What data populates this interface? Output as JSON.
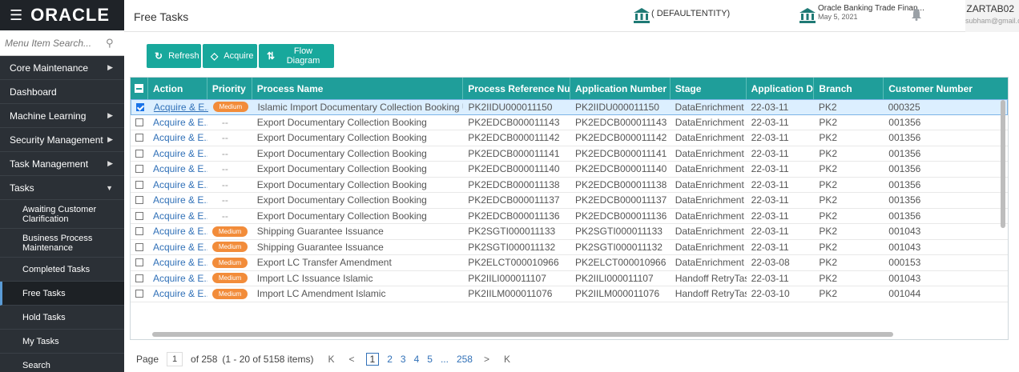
{
  "brand": {
    "logo": "ORACLE"
  },
  "menu": {
    "search_placeholder": "Menu Item Search...",
    "items": [
      {
        "label": "Core Maintenance",
        "has_children": true
      },
      {
        "label": "Dashboard",
        "has_children": false
      },
      {
        "label": "Machine Learning",
        "has_children": true
      },
      {
        "label": "Security Management",
        "has_children": true
      },
      {
        "label": "Task Management",
        "has_children": true
      },
      {
        "label": "Tasks",
        "expanded": true
      }
    ],
    "sub_items": [
      {
        "label": "Awaiting Customer Clarification"
      },
      {
        "label": "Business Process Maintenance"
      },
      {
        "label": "Completed Tasks"
      },
      {
        "label": "Free Tasks",
        "active": true
      },
      {
        "label": "Hold Tasks"
      },
      {
        "label": "My Tasks"
      },
      {
        "label": "Search"
      }
    ]
  },
  "header": {
    "title": "Free Tasks",
    "entity": "( DEFAULTENTITY)",
    "app_name": "Oracle Banking Trade Finan...",
    "app_date": "May 5, 2021",
    "user": "ZARTAB02",
    "email": "subham@gmail.com"
  },
  "toolbar": {
    "refresh": "Refresh",
    "acquire": "Acquire",
    "flow": "Flow Diagram"
  },
  "grid": {
    "columns": [
      "Action",
      "Priority",
      "Process Name",
      "Process Reference Number",
      "Application Number",
      "Stage",
      "Application Date",
      "Branch",
      "Customer Number"
    ],
    "rows": [
      {
        "checked": true,
        "action": "Acquire & E...",
        "priority": "Medium",
        "process": "Islamic Import Documentary Collection Booking Upda...",
        "ref": "PK2IIDU000011150",
        "app": "PK2IIDU000011150",
        "stage": "DataEnrichment",
        "date": "22-03-11",
        "branch": "PK2",
        "customer": "000325"
      },
      {
        "checked": false,
        "action": "Acquire & E...",
        "priority": "--",
        "process": "Export Documentary Collection Booking",
        "ref": "PK2EDCB000011143",
        "app": "PK2EDCB000011143",
        "stage": "DataEnrichment",
        "date": "22-03-11",
        "branch": "PK2",
        "customer": "001356"
      },
      {
        "checked": false,
        "action": "Acquire & E...",
        "priority": "--",
        "process": "Export Documentary Collection Booking",
        "ref": "PK2EDCB000011142",
        "app": "PK2EDCB000011142",
        "stage": "DataEnrichment",
        "date": "22-03-11",
        "branch": "PK2",
        "customer": "001356"
      },
      {
        "checked": false,
        "action": "Acquire & E...",
        "priority": "--",
        "process": "Export Documentary Collection Booking",
        "ref": "PK2EDCB000011141",
        "app": "PK2EDCB000011141",
        "stage": "DataEnrichment",
        "date": "22-03-11",
        "branch": "PK2",
        "customer": "001356"
      },
      {
        "checked": false,
        "action": "Acquire & E...",
        "priority": "--",
        "process": "Export Documentary Collection Booking",
        "ref": "PK2EDCB000011140",
        "app": "PK2EDCB000011140",
        "stage": "DataEnrichment",
        "date": "22-03-11",
        "branch": "PK2",
        "customer": "001356"
      },
      {
        "checked": false,
        "action": "Acquire & E...",
        "priority": "--",
        "process": "Export Documentary Collection Booking",
        "ref": "PK2EDCB000011138",
        "app": "PK2EDCB000011138",
        "stage": "DataEnrichment",
        "date": "22-03-11",
        "branch": "PK2",
        "customer": "001356"
      },
      {
        "checked": false,
        "action": "Acquire & E...",
        "priority": "--",
        "process": "Export Documentary Collection Booking",
        "ref": "PK2EDCB000011137",
        "app": "PK2EDCB000011137",
        "stage": "DataEnrichment",
        "date": "22-03-11",
        "branch": "PK2",
        "customer": "001356"
      },
      {
        "checked": false,
        "action": "Acquire & E...",
        "priority": "--",
        "process": "Export Documentary Collection Booking",
        "ref": "PK2EDCB000011136",
        "app": "PK2EDCB000011136",
        "stage": "DataEnrichment",
        "date": "22-03-11",
        "branch": "PK2",
        "customer": "001356"
      },
      {
        "checked": false,
        "action": "Acquire & E...",
        "priority": "Medium",
        "process": "Shipping Guarantee Issuance",
        "ref": "PK2SGTI000011133",
        "app": "PK2SGTI000011133",
        "stage": "DataEnrichment",
        "date": "22-03-11",
        "branch": "PK2",
        "customer": "001043"
      },
      {
        "checked": false,
        "action": "Acquire & E...",
        "priority": "Medium",
        "process": "Shipping Guarantee Issuance",
        "ref": "PK2SGTI000011132",
        "app": "PK2SGTI000011132",
        "stage": "DataEnrichment",
        "date": "22-03-11",
        "branch": "PK2",
        "customer": "001043"
      },
      {
        "checked": false,
        "action": "Acquire & E...",
        "priority": "Medium",
        "process": "Export LC Transfer Amendment",
        "ref": "PK2ELCT000010966",
        "app": "PK2ELCT000010966",
        "stage": "DataEnrichment",
        "date": "22-03-08",
        "branch": "PK2",
        "customer": "000153"
      },
      {
        "checked": false,
        "action": "Acquire & E...",
        "priority": "Medium",
        "process": "Import LC Issuance Islamic",
        "ref": "PK2IILI000011107",
        "app": "PK2IILI000011107",
        "stage": "Handoff RetryTask",
        "date": "22-03-11",
        "branch": "PK2",
        "customer": "001043"
      },
      {
        "checked": false,
        "action": "Acquire & E...",
        "priority": "Medium",
        "process": "Import LC Amendment Islamic",
        "ref": "PK2IILM000011076",
        "app": "PK2IILM000011076",
        "stage": "Handoff RetryTask",
        "date": "22-03-10",
        "branch": "PK2",
        "customer": "001044"
      }
    ]
  },
  "pager": {
    "label": "Page",
    "current": "1",
    "of": "of 258",
    "summary": "(1 - 20 of 5158 items)",
    "pages": [
      "1",
      "2",
      "3",
      "4",
      "5",
      "...",
      "258"
    ],
    "first": "K",
    "prev": "<",
    "next": ">",
    "last": "K"
  },
  "colors": {
    "teal": "#1f9e9a",
    "button": "#18a89c",
    "badge": "#f28c3a",
    "link": "#3171b8",
    "sidebar": "#2b3036"
  }
}
